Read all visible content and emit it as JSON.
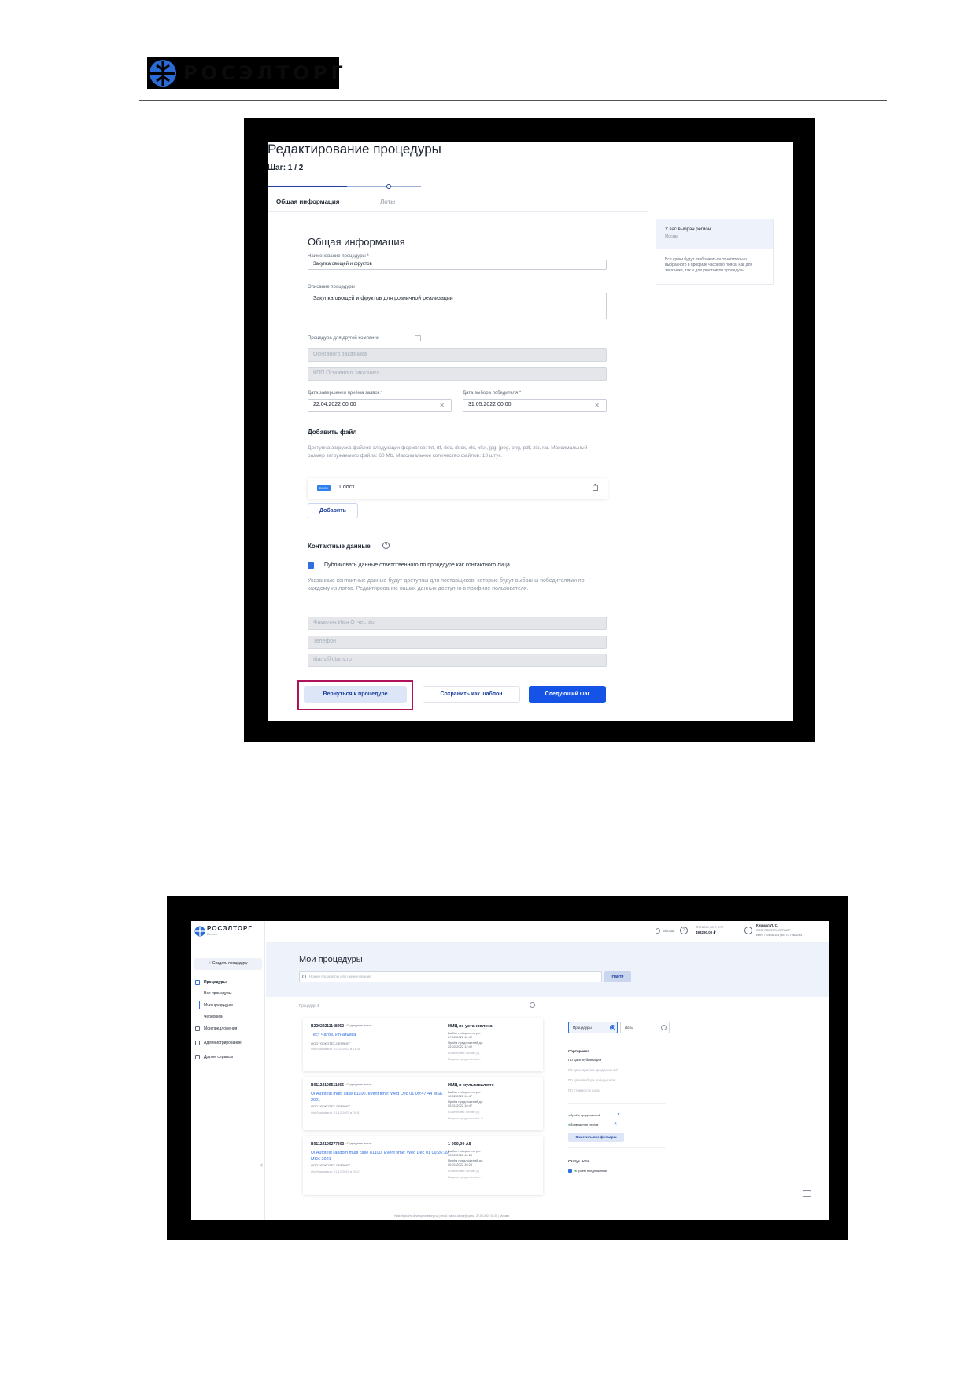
{
  "header": {
    "logo_text": "РОСЭЛТОРГ",
    "logo_icon": "roseltorg-emblem"
  },
  "screenshot1": {
    "title": "Редактирование процедуры",
    "step": "Шаг: 1 / 2",
    "tabs": [
      "Общая информация",
      "Лоты"
    ],
    "aside": {
      "region_label": "У вас выбран регион:",
      "region_value": "Москва",
      "note": "Все сроки будут отображаться относительно выбранного в профиле часового пояса. Как для заказчика, так и для участников процедуры."
    },
    "form": {
      "section_title": "Общая информация",
      "name_label": "Наименование процедуры *",
      "name_value": "Закупка овощей и фруктов",
      "description_label": "Описание процедуры",
      "description_value": "Закупка овощей и фруктов для розничной реализации",
      "other_company_label": "Процедура для другой компании",
      "inn_placeholder": "Основного заказчика",
      "kpp_placeholder": "КПП Основного заказчика",
      "deadline_label": "Дата завершения приёма заявок *",
      "deadline_value": "22.04.2022 00:00",
      "winner_date_label": "Дата выбора победителя *",
      "winner_date_value": "31.05.2022 00:00",
      "file_title": "Добавить файл",
      "file_hint": "Доступна загрузка файлов следующих форматов: txt, rtf, doc, docx, xls, xlsx, jpg, jpeg, png, pdf, zip, rar. Максимальный размер загружаемого файла: 60 Mb. Максимальное количество файлов: 10 штук.",
      "file_badge": "DOCX",
      "file_name": "1.docx",
      "add_button": "Добавить",
      "contacts_title": "Контактные данные",
      "contacts_help": "?",
      "publish_label": "Публиковать данные ответственного по процедуре как контактного лица",
      "contacts_hint": "Указанные контактные данные будут доступны для поставщиков, которые будут выбраны победителями по каждому из лотов. Редактирование ваших данных доступно в профиле пользователя.",
      "fio_placeholder": "Фамилия Имя Отчество",
      "phone_placeholder": "Телефон",
      "email_value": "titans@titans.ru",
      "back_button": "Вернуться к процедуре",
      "template_button": "Сохранить как шаблон",
      "next_button": "Следующий шаг"
    }
  },
  "screenshot2": {
    "logo_text": "РОСЭЛТОРГ",
    "logo_sub": "Бизнес",
    "create_button": "+ Создать процедуру",
    "nav": [
      "Процедуры",
      "Все процедуры",
      "Мои процедуры",
      "Черновики",
      "Мои предложения",
      "Администрирование",
      "Другие сервисы"
    ],
    "top": {
      "city": "Москва",
      "help": "?",
      "balance_label": "Остаток на счете",
      "balance_value": "498290.00 ₽",
      "user_name": "Кирилл Л. С.",
      "user_org": "ООО \"ЛОКОТЕХ-СЕРВИС\"",
      "user_ids": "ИНН: 7704758153 | КПП: 770601001"
    },
    "title": "Мои процедуры",
    "search_placeholder": "Номер процедуры или наименование",
    "find_button": "Найти",
    "count": "Процедур: 4",
    "cards": [
      {
        "number": "B22022211148052",
        "stage": "Подведение итогов",
        "name": "Тест Чатов. Игнатьева",
        "org": "ООО \"ЛОКОТЕХ-СЕРВИС\"",
        "published": "Опубликована: 22.02.2022 в 11:48",
        "price": "НМЦ не установлена",
        "meta": [
          "Выбор победителя до:",
          "27.02.2022 12:42",
          "Приём предложений до:",
          "25.02.2022 12:42"
        ],
        "lots": "Количество лотов: (1)",
        "offers": "Подано предложений: 1"
      },
      {
        "number": "B01122109511265",
        "stage": "Подведение итогов",
        "name": "UI Autotest multi case 81100. event time: Wed Dec 01 09:47:44 MSK 2021",
        "org": "ООО \"ЛОКОТЕХ-СЕРВИС\"",
        "published": "Опубликована: 01.12.2021 в 09:51",
        "price": "НМЦ в мультивалюте",
        "meta": [
          "Выбор победителя до:",
          "08.02.2022 10:47",
          "Приём предложений до:",
          "05.01.2022 10:47"
        ],
        "lots": "Количество лотов: (4)",
        "offers": "Подано предложений: 3"
      },
      {
        "number": "B01122109277303",
        "stage": "Подведение итогов",
        "name": "UI Autotest random multi case 81100. Event time: Wed Dec 01 09:26:39 MSK 2021",
        "org": "ООО \"ЛОКОТЕХ-СЕРВИС\"",
        "published": "Опубликована: 01.12.2021 в 09:21",
        "price": "1 000,00 A$",
        "meta": [
          "Выбор победителя до:",
          "08.02.2022 10:26",
          "Приём предложений до:",
          "05.01.2022 10:26"
        ],
        "lots": "Количество лотов: (1)",
        "offers": "Подано предложений: 1"
      }
    ],
    "filter": {
      "segments": [
        "Процедуры",
        "Лоты"
      ],
      "sort_title": "Сортировка",
      "sort_items": [
        "По дате публикации",
        "По дате приёма предложений",
        "По дате выбора победителя",
        "По стоимости лота"
      ],
      "chips": [
        "Приём предложений",
        "Подведение итогов"
      ],
      "clear_button": "Очистить все фильтры",
      "status_title": "Статус лота",
      "status_item": "Приём предложений"
    },
    "footer": "Host: https://rx-develop.roseltorg.ru/   |   email: takovo-taloge@ya.ru   |   22.03.2022 15:28   |   Москва"
  },
  "colors": {
    "brand_blue": "#1552e6",
    "frame_highlight": "#b0135a",
    "link_blue": "#2f6fe0"
  }
}
